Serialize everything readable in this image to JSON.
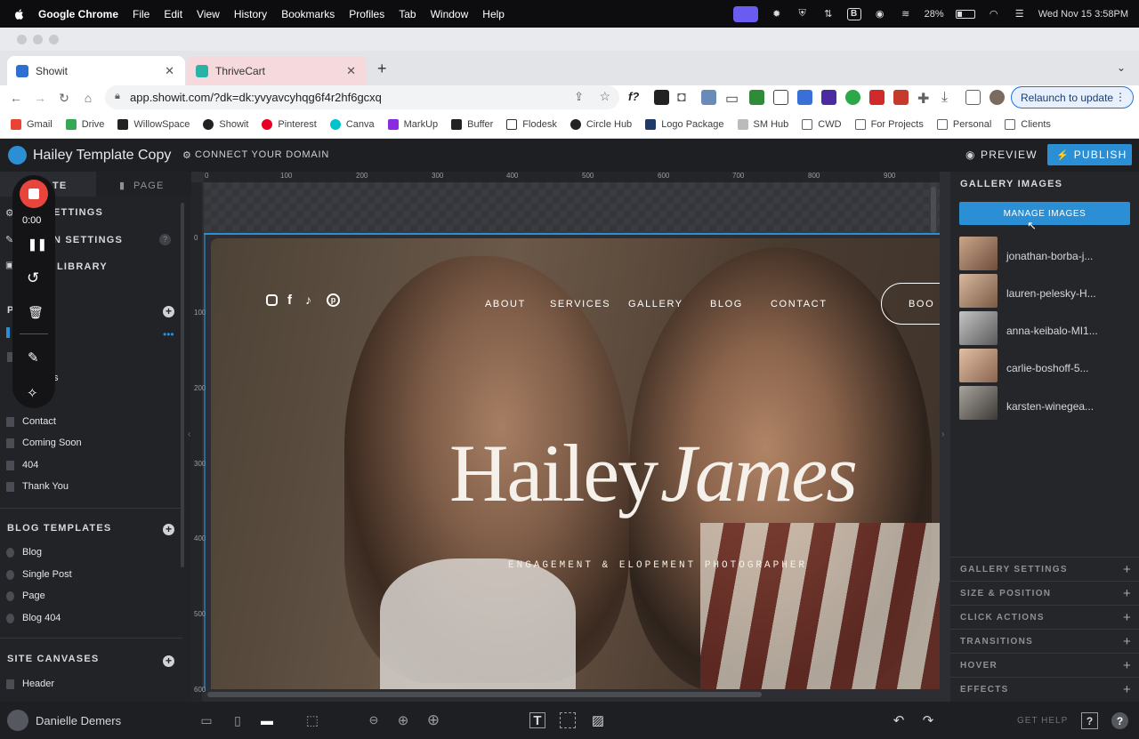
{
  "menubar": {
    "app_name": "Google Chrome",
    "menus": [
      "File",
      "Edit",
      "View",
      "History",
      "Bookmarks",
      "Profiles",
      "Tab",
      "Window",
      "Help"
    ],
    "battery": "28%",
    "datetime": "Wed Nov 15  3:58PM"
  },
  "browser": {
    "tabs": [
      {
        "title": "Showit",
        "active": true,
        "favicon_color": "#2f6fd1"
      },
      {
        "title": "ThriveCart",
        "active": false,
        "favicon_color": "#29b3a5"
      }
    ],
    "url": "app.showit.com/?dk=dk:yvyavcyhqg6f4r2hf6gcxq",
    "relaunch_label": "Relaunch to update",
    "bookmarks": [
      "Gmail",
      "Drive",
      "WillowSpace",
      "Showit",
      "Pinterest",
      "Canva",
      "MarkUp",
      "Buffer",
      "Flodesk",
      "Circle Hub",
      "Logo Package",
      "SM Hub",
      "CWD",
      "For Projects",
      "Personal",
      "Clients"
    ]
  },
  "app": {
    "site_title": "Hailey Template Copy",
    "connect_domain": "CONNECT YOUR DOMAIN",
    "preview_label": "PREVIEW",
    "publish_label": "PUBLISH"
  },
  "left_panel": {
    "tab_site": "TE",
    "tab_page": "PAGE",
    "items_top": [
      "ETTINGS",
      "N SETTINGS",
      "LIBRARY"
    ],
    "pages_header": "P",
    "pages": [
      "s",
      "Contact",
      "Coming Soon",
      "404",
      "Thank You"
    ],
    "blog_header": "BLOG TEMPLATES",
    "blog_items": [
      "Blog",
      "Single Post",
      "Page",
      "Blog 404"
    ],
    "canvases_header": "SITE CANVASES",
    "canvas_items": [
      "Header"
    ]
  },
  "recorder": {
    "time": "0:00"
  },
  "canvas": {
    "ruler_x": [
      "0",
      "100",
      "200",
      "300",
      "400",
      "500",
      "600",
      "700",
      "800",
      "900"
    ],
    "ruler_y": [
      "0",
      "100",
      "200",
      "300",
      "400",
      "500",
      "600"
    ],
    "nav": [
      "ABOUT",
      "SERVICES",
      "GALLERY",
      "BLOG",
      "CONTACT"
    ],
    "book_button": "BOO",
    "hero_first": "Hailey",
    "hero_second": "James",
    "tagline": "ENGAGEMENT & ELOPEMENT PHOTOGRAPHER"
  },
  "right_panel": {
    "header": "GALLERY IMAGES",
    "manage_button": "MANAGE IMAGES",
    "images": [
      {
        "name": "jonathan-borba-j...",
        "color": "#8a6d5c"
      },
      {
        "name": "lauren-pelesky-H...",
        "color": "#9b7a62"
      },
      {
        "name": "anna-keibalo-MI1...",
        "color": "#8f8f8f"
      },
      {
        "name": "carlie-boshoff-5...",
        "color": "#a7816a"
      },
      {
        "name": "karsten-winegea...",
        "color": "#6e6a66"
      }
    ],
    "sections": [
      "GALLERY SETTINGS",
      "SIZE & POSITION",
      "CLICK ACTIONS",
      "TRANSITIONS",
      "HOVER",
      "EFFECTS"
    ]
  },
  "bottom_bar": {
    "user_name": "Danielle Demers",
    "get_help": "GET HELP"
  },
  "colors": {
    "accent_blue": "#2b8fd6",
    "record_red": "#e8453c"
  }
}
